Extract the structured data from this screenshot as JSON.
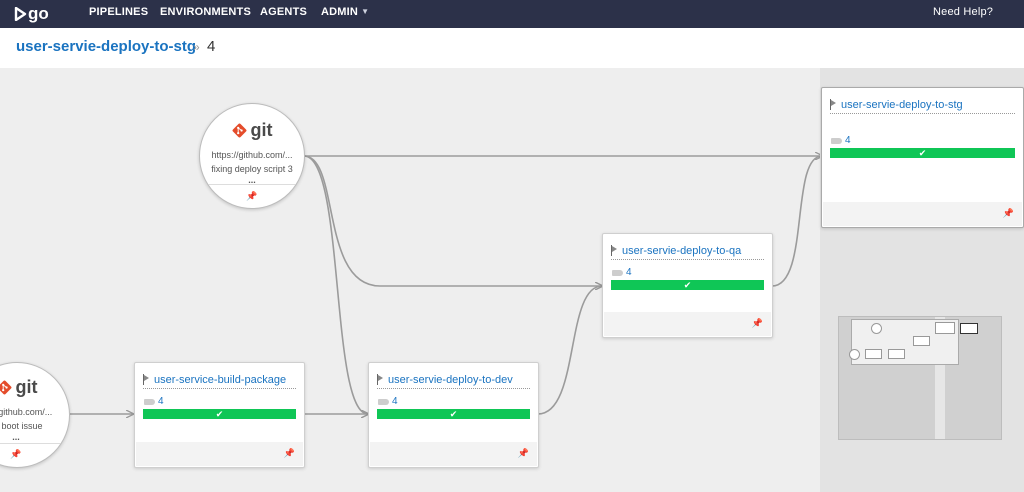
{
  "nav": {
    "logo_text": "go",
    "items": [
      "PIPELINES",
      "ENVIRONMENTS",
      "AGENTS",
      "ADMIN"
    ],
    "help": "Need Help?"
  },
  "breadcrumb": {
    "pipeline": "user-servie-deploy-to-stg",
    "separator": "»",
    "counter": "4"
  },
  "materials": [
    {
      "type": "git",
      "url": "https://github.com/...",
      "message": "fixing deploy script 3",
      "more": "..."
    },
    {
      "type": "git",
      "url": "/github.com/...",
      "message": "boot issue",
      "more": "..."
    }
  ],
  "pipelines": [
    {
      "name": "user-servie-deploy-to-stg",
      "counter": "4",
      "status": "passed"
    },
    {
      "name": "user-servie-deploy-to-qa",
      "counter": "4",
      "status": "passed"
    },
    {
      "name": "user-service-build-package",
      "counter": "4",
      "status": "passed"
    },
    {
      "name": "user-servie-deploy-to-dev",
      "counter": "4",
      "status": "passed"
    }
  ],
  "colors": {
    "nav_bg": "#2c3149",
    "link": "#1a73c0",
    "passed": "#0fc656",
    "git": "#e44c2b"
  },
  "icons": {
    "pin": "📌",
    "check": "✔"
  }
}
